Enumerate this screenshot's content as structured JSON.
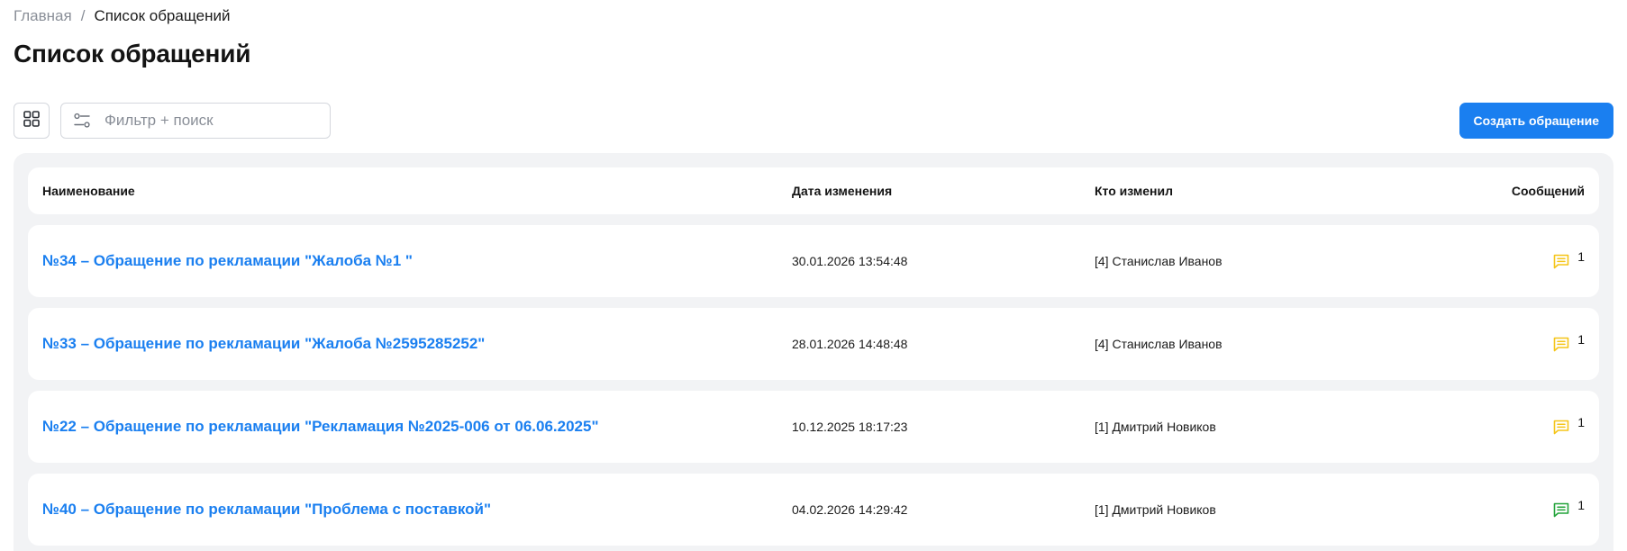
{
  "breadcrumb": {
    "home": "Главная",
    "separator": "/",
    "current": "Список обращений"
  },
  "page": {
    "title": "Список обращений"
  },
  "toolbar": {
    "view_toggle_icon": "grid-icon",
    "search_placeholder": "Фильтр + поиск",
    "search_value": "",
    "filter_icon": "filter-settings-icon",
    "create_button_label": "Создать обращение",
    "accent_color": "#1a7ff0"
  },
  "table": {
    "headers": {
      "name": "Наименование",
      "date": "Дата изменения",
      "author": "Кто изменил",
      "messages": "Сообщений"
    },
    "rows": [
      {
        "title": "№34 – Обращение по рекламации \"Жалоба №1 \"",
        "date": "30.01.2026 13:54:48",
        "author": "[4] Станислав Иванов",
        "messages": "1",
        "message_icon": "chat-message-icon",
        "message_icon_color": "#f5c518"
      },
      {
        "title": "№33 – Обращение по рекламации \"Жалоба №2595285252\"",
        "date": "28.01.2026 14:48:48",
        "author": "[4] Станислав Иванов",
        "messages": "1",
        "message_icon": "chat-message-icon",
        "message_icon_color": "#f5c518"
      },
      {
        "title": "№22 – Обращение по рекламации \"Рекламация №2025-006 от 06.06.2025\"",
        "date": "10.12.2025 18:17:23",
        "author": "[1] Дмитрий Новиков",
        "messages": "1",
        "message_icon": "chat-message-icon",
        "message_icon_color": "#f5c518"
      },
      {
        "title": "№40 – Обращение по рекламации \"Проблема с поставкой\"",
        "date": "04.02.2026 14:29:42",
        "author": "[1] Дмитрий Новиков",
        "messages": "1",
        "message_icon": "chat-message-icon",
        "message_icon_color": "#22a33a"
      }
    ]
  }
}
